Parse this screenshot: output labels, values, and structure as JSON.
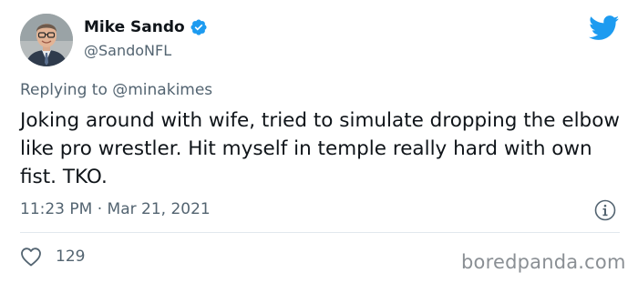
{
  "author": {
    "name": "Mike Sando",
    "handle": "@SandoNFL",
    "verified": true
  },
  "reply": {
    "prefix": "Replying to ",
    "mention": "@minakimes"
  },
  "tweet": {
    "text": "Joking around with wife, tried to simulate dropping the elbow like pro wrestler. Hit myself in temple really hard with own fist. TKO.",
    "timestamp": "11:23 PM · Mar 21, 2021"
  },
  "actions": {
    "likes": "129"
  },
  "icons": {
    "brand": "twitter-bird-icon",
    "verified": "verified-badge-icon",
    "info": "info-icon",
    "like": "heart-icon"
  },
  "colors": {
    "brand": "#1d9bf0",
    "secondary_text": "#536471",
    "primary_text": "#0f1419"
  },
  "watermark": "boredpanda.com"
}
